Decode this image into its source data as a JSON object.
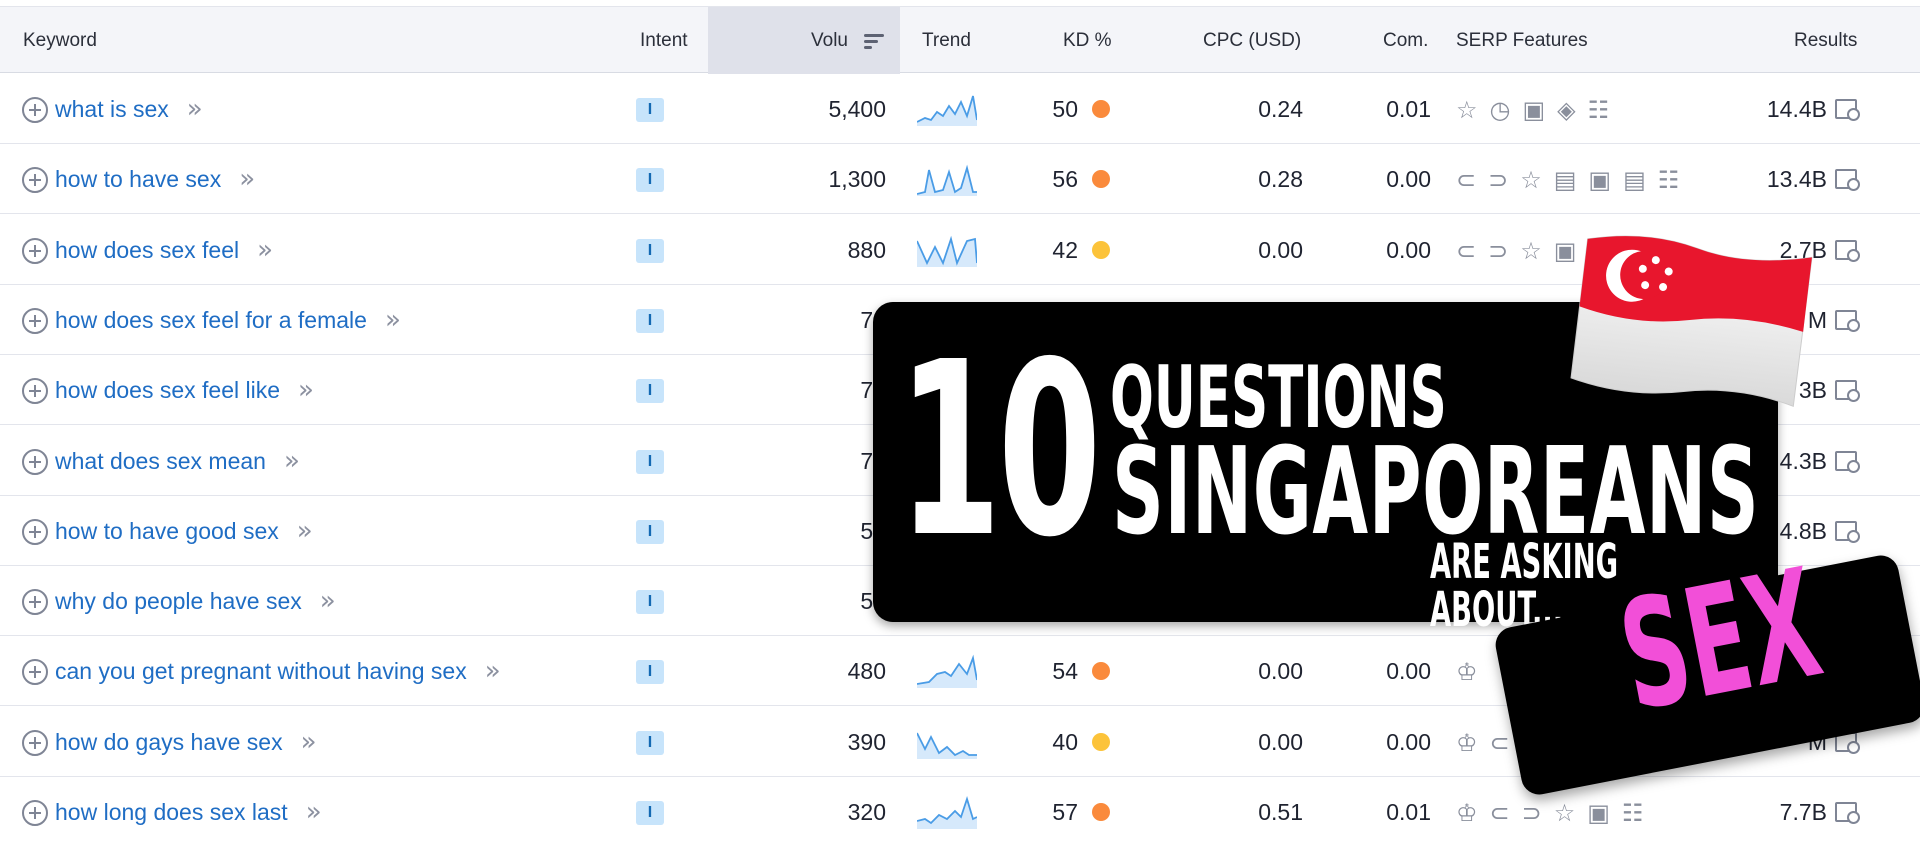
{
  "header": {
    "keyword": "Keyword",
    "intent": "Intent",
    "volume": "Volu",
    "trend": "Trend",
    "kd": "KD %",
    "cpc": "CPC (USD)",
    "com": "Com.",
    "serp": "SERP Features",
    "results": "Results"
  },
  "colors": {
    "link": "#1f6dc4",
    "kd_orange": "#fa8a3c",
    "kd_yellow": "#fcc33a",
    "sex_pink": "#f24fd8"
  },
  "rows": [
    {
      "keyword": "what is sex",
      "intent": "I",
      "volume": "5,400",
      "kd": "50",
      "kd_color": "#fa8a3c",
      "cpc": "0.24",
      "com": "0.01",
      "serp": "☆◷▣◈☷",
      "results": "14.4B"
    },
    {
      "keyword": "how to have sex",
      "intent": "I",
      "volume": "1,300",
      "kd": "56",
      "kd_color": "#fa8a3c",
      "cpc": "0.28",
      "com": "0.00",
      "serp": "⊂⊃☆▤▣▤☷",
      "results": "13.4B"
    },
    {
      "keyword": "how does sex feel",
      "intent": "I",
      "volume": "880",
      "kd": "42",
      "kd_color": "#fcc33a",
      "cpc": "0.00",
      "com": "0.00",
      "serp": "⊂⊃☆▣☷",
      "results": "2.7B"
    },
    {
      "keyword": "how does sex feel for a female",
      "intent": "I",
      "volume": "72",
      "kd": "",
      "kd_color": "",
      "cpc": "",
      "com": "",
      "serp": "",
      "results": "M"
    },
    {
      "keyword": "how does sex feel like",
      "intent": "I",
      "volume": "72",
      "kd": "",
      "kd_color": "",
      "cpc": "",
      "com": "",
      "serp": "",
      "results": "3B"
    },
    {
      "keyword": "what does sex mean",
      "intent": "I",
      "volume": "72",
      "kd": "",
      "kd_color": "",
      "cpc": "",
      "com": "",
      "serp": "",
      "results": "4.3B"
    },
    {
      "keyword": "how to have good sex",
      "intent": "I",
      "volume": "59",
      "kd": "",
      "kd_color": "",
      "cpc": "",
      "com": "",
      "serp": "",
      "results": "4.8B"
    },
    {
      "keyword": "why do people have sex",
      "intent": "I",
      "volume": "59",
      "kd": "",
      "kd_color": "",
      "cpc": "",
      "com": "",
      "serp": "",
      "results": ""
    },
    {
      "keyword": "can you get pregnant without having sex",
      "intent": "I",
      "volume": "480",
      "kd": "54",
      "kd_color": "#fa8a3c",
      "cpc": "0.00",
      "com": "0.00",
      "serp": "♔",
      "results": ""
    },
    {
      "keyword": "how do gays have sex",
      "intent": "I",
      "volume": "390",
      "kd": "40",
      "kd_color": "#fcc33a",
      "cpc": "0.00",
      "com": "0.00",
      "serp": "♔⊂",
      "results": "M"
    },
    {
      "keyword": "how long does sex last",
      "intent": "I",
      "volume": "320",
      "kd": "57",
      "kd_color": "#fa8a3c",
      "cpc": "0.51",
      "com": "0.01",
      "serp": "♔⊂⊃☆▣☷",
      "results": "7.7B"
    }
  ],
  "overlay": {
    "number": "10",
    "questions": "QUESTIONS",
    "singaporeans": "SINGAPOREANS",
    "asking": "ARE ASKING ABOUT...",
    "sex": "SEX",
    "flag": "singapore-flag"
  }
}
